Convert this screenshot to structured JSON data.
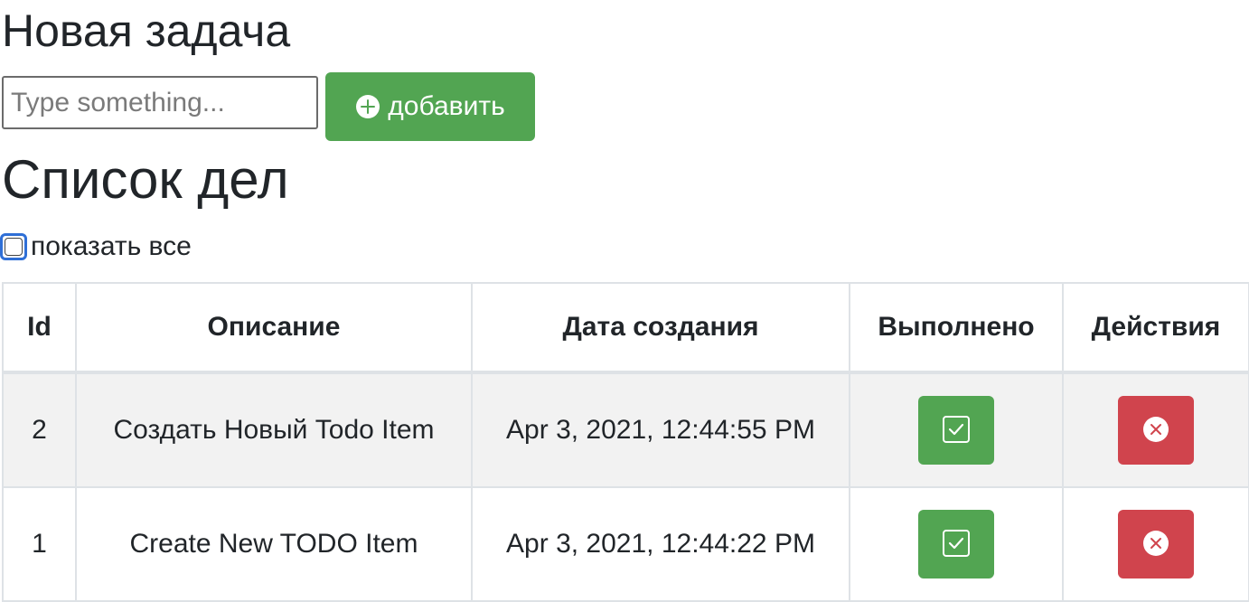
{
  "new_task": {
    "heading": "Новая задача",
    "input_placeholder": "Type something...",
    "input_value": "",
    "add_button_label": "добавить",
    "add_icon": "plus-circle-icon"
  },
  "list": {
    "heading": "Список дел",
    "show_all_label": "показать все",
    "show_all_checked": false
  },
  "table": {
    "columns": [
      "Id",
      "Описание",
      "Дата создания",
      "Выполнено",
      "Действия"
    ],
    "rows": [
      {
        "id": "2",
        "description": "Создать Новый Todo Item",
        "created": "Apr 3, 2021, 12:44:55 PM"
      },
      {
        "id": "1",
        "description": "Create New TODO Item",
        "created": "Apr 3, 2021, 12:44:22 PM"
      }
    ],
    "done_icon": "check-square-icon",
    "delete_icon": "x-circle-icon"
  },
  "colors": {
    "success": "#52a552",
    "danger": "#d0444d",
    "striped_row": "#f2f2f2",
    "border": "#dee2e6",
    "focus": "#2f6fd6"
  }
}
